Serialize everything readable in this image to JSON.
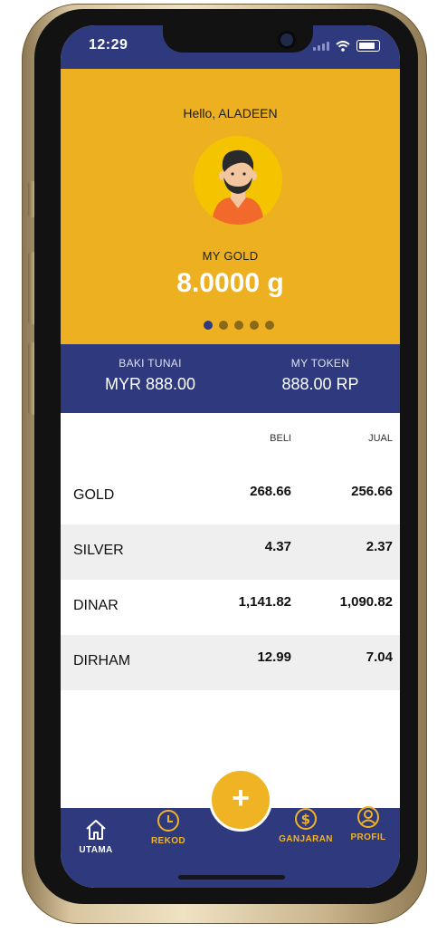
{
  "status_bar": {
    "time": "12:29"
  },
  "header": {
    "greeting": "Hello, ALADEEN",
    "gold_label": "MY GOLD",
    "gold_value": "8.0000 g",
    "carousel_pages": 5,
    "carousel_active": 1
  },
  "balance": {
    "cash_label": "BAKI TUNAI",
    "cash_value": "MYR 888.00",
    "token_label": "MY TOKEN",
    "token_value": "888.00 RP"
  },
  "prices": {
    "col_buy": "BELI",
    "col_sell": "JUAL",
    "rows": [
      {
        "name": "GOLD",
        "buy": "268.66",
        "sell": "256.66"
      },
      {
        "name": "SILVER",
        "buy": "4.37",
        "sell": "2.37"
      },
      {
        "name": "DINAR",
        "buy": "1,141.82",
        "sell": "1,090.82"
      },
      {
        "name": "DIRHAM",
        "buy": "12.99",
        "sell": "7.04"
      }
    ]
  },
  "tabbar": {
    "home": "UTAMA",
    "records": "REKOD",
    "fab_symbol": "+",
    "rewards": "GANJARAN",
    "profile": "PROFIL"
  },
  "colors": {
    "navy": "#2f3a7e",
    "gold": "#edb020",
    "active_tab": "#ffffff",
    "inactive_tab": "#f0b323"
  },
  "icons": [
    "home-icon",
    "clock-icon",
    "plus-icon",
    "dollar-icon",
    "user-icon",
    "wifi-icon",
    "battery-icon",
    "signal-icon"
  ]
}
